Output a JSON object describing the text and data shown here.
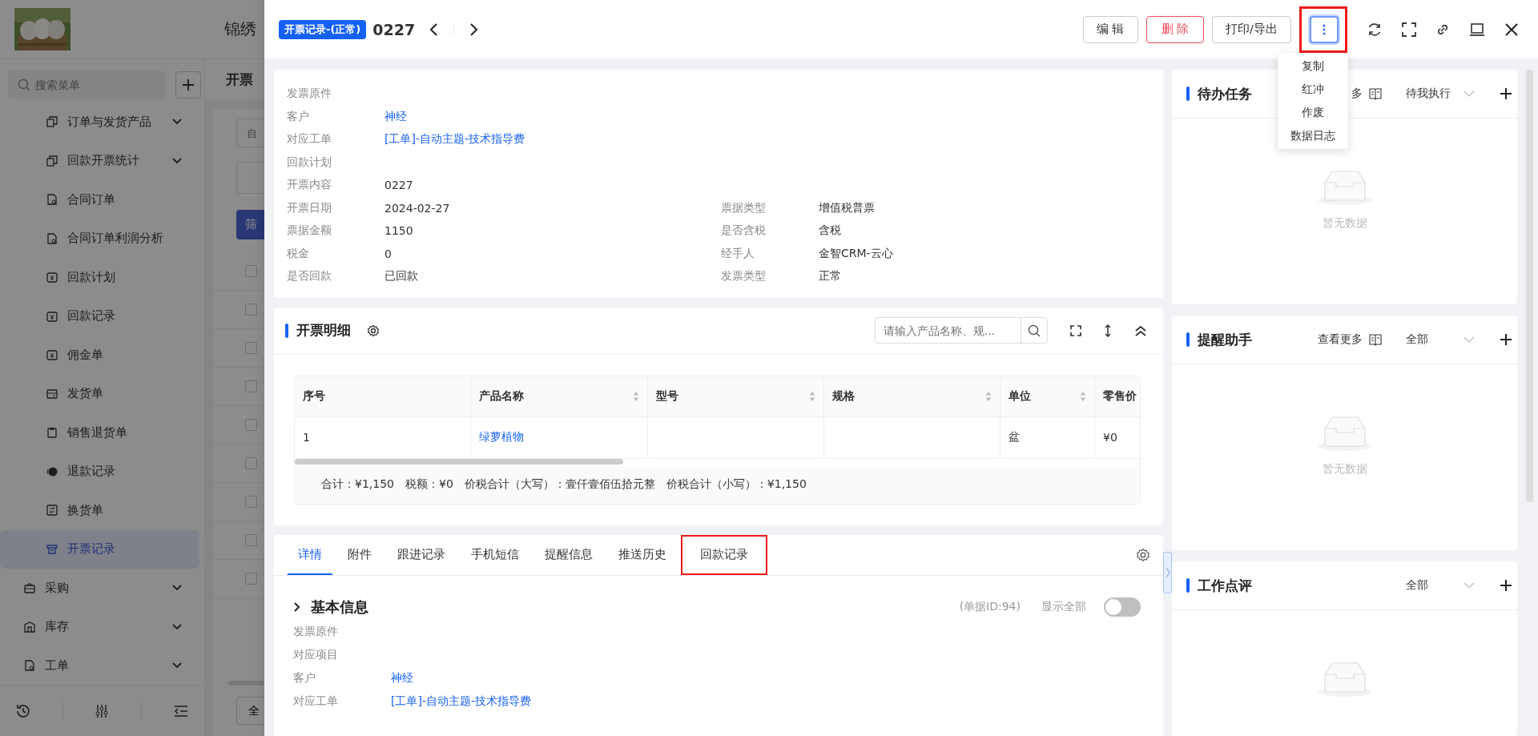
{
  "background_page": {
    "app_name": "锦绣",
    "search": {
      "placeholder": "搜索菜单"
    },
    "menu": [
      {
        "label": "订单与发货产品",
        "kind": "sub",
        "expandable": true,
        "selected": false
      },
      {
        "label": "回款开票统计",
        "kind": "sub",
        "expandable": true,
        "selected": false
      },
      {
        "label": "合同订单",
        "kind": "sub",
        "expandable": false,
        "selected": false
      },
      {
        "label": "合同订单利润分析",
        "kind": "sub",
        "expandable": false,
        "selected": false
      },
      {
        "label": "回款计划",
        "kind": "sub",
        "expandable": false,
        "selected": false
      },
      {
        "label": "回款记录",
        "kind": "sub",
        "expandable": false,
        "selected": false
      },
      {
        "label": "佣金单",
        "kind": "sub",
        "expandable": false,
        "selected": false
      },
      {
        "label": "发货单",
        "kind": "sub",
        "expandable": false,
        "selected": false
      },
      {
        "label": "销售退货单",
        "kind": "sub",
        "expandable": false,
        "selected": false
      },
      {
        "label": "退款记录",
        "kind": "sub",
        "expandable": false,
        "selected": false
      },
      {
        "label": "换货单",
        "kind": "sub",
        "expandable": false,
        "selected": false
      },
      {
        "label": "开票记录",
        "kind": "sub",
        "expandable": false,
        "selected": true
      },
      {
        "label": "采购",
        "kind": "top",
        "expandable": true,
        "selected": false
      },
      {
        "label": "库存",
        "kind": "top",
        "expandable": true,
        "selected": false
      },
      {
        "label": "工单",
        "kind": "top",
        "expandable": true,
        "selected": false
      }
    ],
    "page_title": "开票",
    "filter_field": {
      "placeholder": "自"
    },
    "filter_button": "筛",
    "rows": [
      {
        "checked": false
      },
      {
        "checked": false
      },
      {
        "checked": false
      },
      {
        "checked": false
      },
      {
        "checked": false
      },
      {
        "checked": false
      },
      {
        "checked": false
      },
      {
        "checked": false
      },
      {
        "checked": false
      }
    ],
    "footer_button": "全"
  },
  "drawer": {
    "badge": "开票记录-(正常)",
    "title": "0227",
    "actions": [
      {
        "label": "编 辑",
        "kind": "default"
      },
      {
        "label": "删 除",
        "kind": "danger"
      },
      {
        "label": "打印/导出",
        "kind": "default"
      }
    ],
    "more_menu": {
      "expanded": true,
      "highlighted": true,
      "items": [
        "复制",
        "红冲",
        "作废",
        "数据日志"
      ]
    },
    "info": [
      {
        "cells": [
          {
            "label": "发票原件"
          }
        ]
      },
      {
        "cells": [
          {
            "label": "客户",
            "value": "神经",
            "link": true
          }
        ]
      },
      {
        "cells": [
          {
            "label": "对应工单",
            "value": "[工单]-自动主题-技术指导费",
            "link": true
          }
        ]
      },
      {
        "cells": [
          {
            "label": "回款计划"
          }
        ]
      },
      {
        "cells": [
          {
            "label": "开票内容",
            "value": "0227",
            "link": false
          }
        ]
      },
      {
        "cells": [
          {
            "label": "开票日期",
            "value": "2024-02-27",
            "link": false
          },
          {
            "label": "票据类型",
            "value": "增值税普票",
            "link": false
          }
        ]
      },
      {
        "cells": [
          {
            "label": "票据金额",
            "value": "1150",
            "link": false
          },
          {
            "label": "是否含税",
            "value": "含税",
            "link": false
          }
        ]
      },
      {
        "cells": [
          {
            "label": "税金",
            "value": "0",
            "link": false
          },
          {
            "label": "经手人",
            "value": "金智CRM-云心",
            "link": false
          }
        ]
      },
      {
        "cells": [
          {
            "label": "是否回款",
            "value": "已回款",
            "link": false
          },
          {
            "label": "发票类型",
            "value": "正常",
            "link": false
          }
        ]
      }
    ],
    "invoice_detail": {
      "title": "开票明细",
      "search": {
        "placeholder": "请输入产品名称、规..."
      },
      "columns": [
        {
          "label": "序号",
          "sortable": false
        },
        {
          "label": "产品名称",
          "sortable": true
        },
        {
          "label": "型号",
          "sortable": true
        },
        {
          "label": "规格",
          "sortable": true
        },
        {
          "label": "单位",
          "sortable": true
        },
        {
          "label": "零售价"
        }
      ],
      "rows": [
        [
          {
            "text": "1"
          },
          {
            "text": "绿萝植物",
            "link": true
          },
          {},
          {},
          {
            "text": "盆"
          },
          {
            "text": "¥0"
          }
        ]
      ],
      "summary": [
        "合计：¥1,150",
        "税额：¥0",
        "价税合计（大写）：壹仟壹佰伍拾元整",
        "价税合计（小写）：¥1,150"
      ]
    },
    "record_tabs": {
      "tabs": [
        {
          "label": "详情",
          "selected": true,
          "highlighted": false
        },
        {
          "label": "附件",
          "selected": false,
          "highlighted": false
        },
        {
          "label": "跟进记录",
          "selected": false,
          "highlighted": false
        },
        {
          "label": "手机短信",
          "selected": false,
          "highlighted": false
        },
        {
          "label": "提醒信息",
          "selected": false,
          "highlighted": false
        },
        {
          "label": "推送历史",
          "selected": false,
          "highlighted": false
        },
        {
          "label": "回款记录",
          "selected": false,
          "highlighted": true
        }
      ],
      "section_title": "基本信息",
      "record_id": "(单据ID:94)",
      "show_all": {
        "label": "显示全部",
        "on": false
      },
      "fields": [
        {
          "label": "发票原件"
        },
        {
          "label": "对应项目"
        },
        {
          "label": "客户",
          "value": "神经",
          "link": true
        },
        {
          "label": "对应工单",
          "value": "[工单]-自动主题-技术指导费",
          "link": true
        }
      ]
    },
    "panels": [
      {
        "title": "待办任务",
        "more": "多",
        "filter": "待我执行",
        "empty_text": "暂无数据"
      },
      {
        "title": "提醒助手",
        "more": "查看更多",
        "filter": "全部",
        "empty_text": "暂无数据"
      },
      {
        "title": "工作点评",
        "filter": "全部"
      }
    ]
  }
}
